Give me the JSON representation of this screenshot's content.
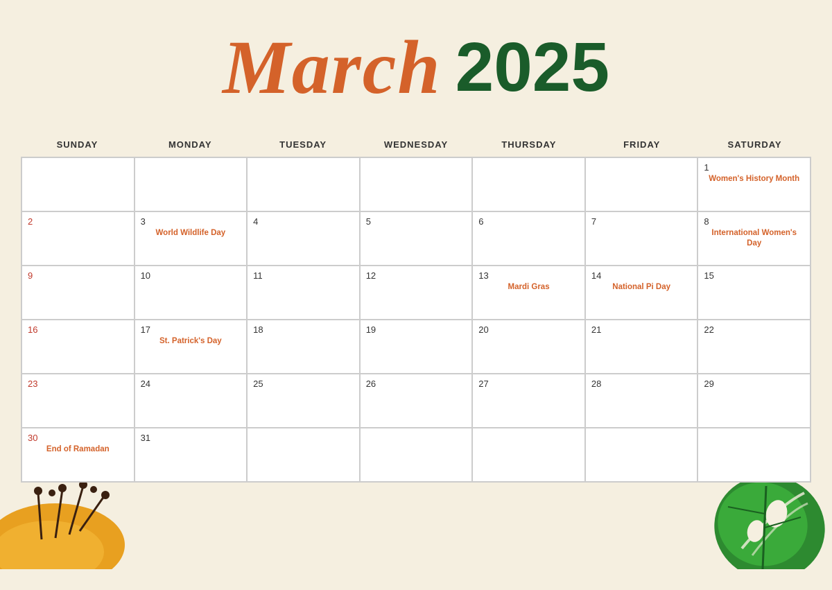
{
  "header": {
    "month": "March",
    "year": "2025"
  },
  "weekdays": [
    "SUNDAY",
    "MONDAY",
    "TUESDAY",
    "WEDNESDAY",
    "THURSDAY",
    "FRIDAY",
    "SATURDAY"
  ],
  "cells": [
    {
      "date": "",
      "event": "",
      "red_date": false
    },
    {
      "date": "",
      "event": "",
      "red_date": false
    },
    {
      "date": "",
      "event": "",
      "red_date": false
    },
    {
      "date": "",
      "event": "",
      "red_date": false
    },
    {
      "date": "",
      "event": "",
      "red_date": false
    },
    {
      "date": "",
      "event": "",
      "red_date": false
    },
    {
      "date": "1",
      "event": "Women's History Month",
      "red_date": false,
      "event_color": "orange"
    },
    {
      "date": "2",
      "event": "",
      "red_date": true
    },
    {
      "date": "3",
      "event": "World Wildlife Day",
      "red_date": false,
      "event_color": "orange"
    },
    {
      "date": "4",
      "event": "",
      "red_date": false
    },
    {
      "date": "5",
      "event": "",
      "red_date": false
    },
    {
      "date": "6",
      "event": "",
      "red_date": false
    },
    {
      "date": "7",
      "event": "",
      "red_date": false
    },
    {
      "date": "8",
      "event": "International Women's Day",
      "red_date": false,
      "event_color": "orange"
    },
    {
      "date": "9",
      "event": "",
      "red_date": true
    },
    {
      "date": "10",
      "event": "",
      "red_date": false
    },
    {
      "date": "11",
      "event": "",
      "red_date": false
    },
    {
      "date": "12",
      "event": "",
      "red_date": false
    },
    {
      "date": "13",
      "event": "Mardi Gras",
      "red_date": false,
      "event_color": "orange"
    },
    {
      "date": "14",
      "event": "National Pi Day",
      "red_date": false,
      "event_color": "orange"
    },
    {
      "date": "15",
      "event": "",
      "red_date": false
    },
    {
      "date": "16",
      "event": "",
      "red_date": true
    },
    {
      "date": "17",
      "event": "St. Patrick's Day",
      "red_date": false,
      "event_color": "orange"
    },
    {
      "date": "18",
      "event": "",
      "red_date": false
    },
    {
      "date": "19",
      "event": "",
      "red_date": false
    },
    {
      "date": "20",
      "event": "",
      "red_date": false
    },
    {
      "date": "21",
      "event": "",
      "red_date": false
    },
    {
      "date": "22",
      "event": "",
      "red_date": false
    },
    {
      "date": "23",
      "event": "",
      "red_date": true
    },
    {
      "date": "24",
      "event": "",
      "red_date": false
    },
    {
      "date": "25",
      "event": "",
      "red_date": false
    },
    {
      "date": "26",
      "event": "",
      "red_date": false
    },
    {
      "date": "27",
      "event": "",
      "red_date": false
    },
    {
      "date": "28",
      "event": "",
      "red_date": false
    },
    {
      "date": "29",
      "event": "",
      "red_date": false
    },
    {
      "date": "30",
      "event": "End of Ramadan",
      "red_date": true,
      "event_color": "orange"
    },
    {
      "date": "31",
      "event": "",
      "red_date": false
    },
    {
      "date": "",
      "event": "",
      "red_date": false
    },
    {
      "date": "",
      "event": "",
      "red_date": false
    },
    {
      "date": "",
      "event": "",
      "red_date": false
    },
    {
      "date": "",
      "event": "",
      "red_date": false
    },
    {
      "date": "",
      "event": "",
      "red_date": false
    }
  ]
}
